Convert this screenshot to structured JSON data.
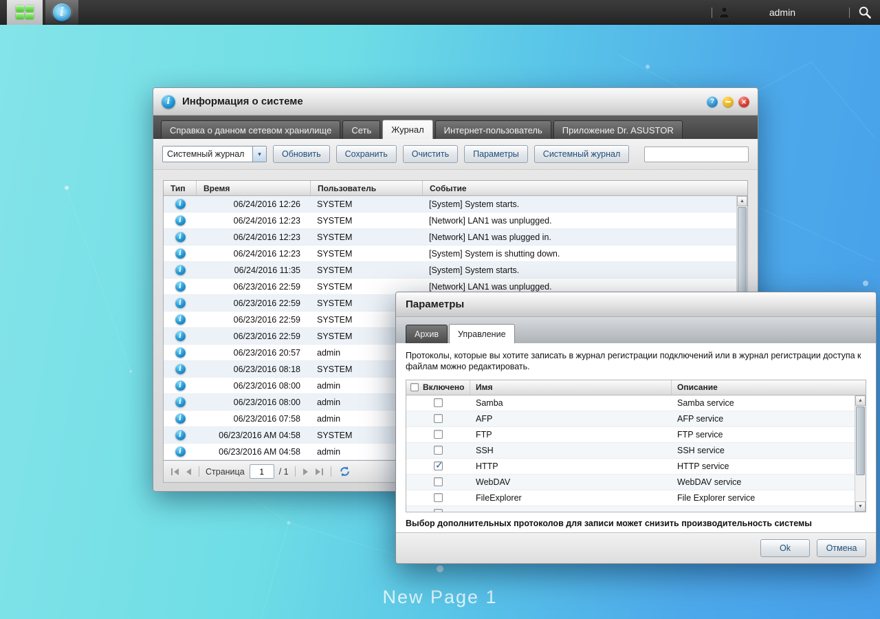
{
  "theme": {
    "accent_blue": "#2b7bc8",
    "info_icon_blue": "#2196d4",
    "button_text_blue": "#1f4e79",
    "desktop_gradient_left": "#84e4e9",
    "desktop_gradient_right": "#479fe9",
    "stripe_row": "#ecf2f7"
  },
  "icons": {
    "info_glyph": "i",
    "help_glyph": "?",
    "close_glyph": "×",
    "combo_arrow": "▾",
    "scroll_up": "▲",
    "scroll_down": "▼"
  },
  "taskbar": {
    "username": "admin"
  },
  "desktop": {
    "caption": "New Page 1"
  },
  "window": {
    "title": "Информация о системе",
    "tabs": [
      {
        "label": "Справка о данном сетевом хранилище",
        "active": false
      },
      {
        "label": "Сеть",
        "active": false
      },
      {
        "label": "Журнал",
        "active": true
      },
      {
        "label": "Интернет-пользователь",
        "active": false
      },
      {
        "label": "Приложение Dr. ASUSTOR",
        "active": false
      }
    ],
    "toolbar": {
      "dropdown_value": "Системный журнал",
      "buttons": [
        "Обновить",
        "Сохранить",
        "Очистить",
        "Параметры",
        "Системный журнал"
      ],
      "filter_value": ""
    },
    "table": {
      "columns": [
        "Тип",
        "Время",
        "Пользователь",
        "Событие"
      ],
      "rows": [
        {
          "time": "06/24/2016 12:26",
          "user": "SYSTEM",
          "event": "[System] System starts."
        },
        {
          "time": "06/24/2016 12:23",
          "user": "SYSTEM",
          "event": "[Network] LAN1 was unplugged."
        },
        {
          "time": "06/24/2016 12:23",
          "user": "SYSTEM",
          "event": "[Network] LAN1 was plugged in."
        },
        {
          "time": "06/24/2016 12:23",
          "user": "SYSTEM",
          "event": "[System] System is shutting down."
        },
        {
          "time": "06/24/2016 11:35",
          "user": "SYSTEM",
          "event": "[System] System starts."
        },
        {
          "time": "06/23/2016 22:59",
          "user": "SYSTEM",
          "event": "[Network] LAN1 was unplugged."
        },
        {
          "time": "06/23/2016 22:59",
          "user": "SYSTEM",
          "event": ""
        },
        {
          "time": "06/23/2016 22:59",
          "user": "SYSTEM",
          "event": ""
        },
        {
          "time": "06/23/2016 22:59",
          "user": "SYSTEM",
          "event": ""
        },
        {
          "time": "06/23/2016 20:57",
          "user": "admin",
          "event": ""
        },
        {
          "time": "06/23/2016 08:18",
          "user": "SYSTEM",
          "event": ""
        },
        {
          "time": "06/23/2016 08:00",
          "user": "admin",
          "event": ""
        },
        {
          "time": "06/23/2016 08:00",
          "user": "admin",
          "event": ""
        },
        {
          "time": "06/23/2016 07:58",
          "user": "admin",
          "event": ""
        },
        {
          "time": "06/23/2016 AM 04:58",
          "user": "SYSTEM",
          "event": ""
        },
        {
          "time": "06/23/2016 AM 04:58",
          "user": "admin",
          "event": ""
        }
      ]
    },
    "pagination": {
      "page_label": "Страница",
      "current_page": "1",
      "total_label": "/ 1"
    }
  },
  "dialog": {
    "title": "Параметры",
    "tabs": [
      {
        "label": "Архив",
        "active": false
      },
      {
        "label": "Управление",
        "active": true
      }
    ],
    "description": "Протоколы, которые вы хотите записать в журнал регистрации подключений или в журнал регистрации доступа к файлам можно редактировать.",
    "table": {
      "columns": [
        "Включено",
        "Имя",
        "Описание"
      ],
      "rows": [
        {
          "enabled": false,
          "name": "Samba",
          "desc": "Samba service"
        },
        {
          "enabled": false,
          "name": "AFP",
          "desc": "AFP service"
        },
        {
          "enabled": false,
          "name": "FTP",
          "desc": "FTP service"
        },
        {
          "enabled": false,
          "name": "SSH",
          "desc": "SSH service"
        },
        {
          "enabled": true,
          "name": "HTTP",
          "desc": "HTTP service"
        },
        {
          "enabled": false,
          "name": "WebDAV",
          "desc": "WebDAV service"
        },
        {
          "enabled": false,
          "name": "FileExplorer",
          "desc": "File Explorer service"
        },
        {
          "enabled": false,
          "name": "",
          "desc": ""
        }
      ]
    },
    "warning": "Выбор дополнительных протоколов для записи может снизить производительность системы",
    "buttons": {
      "ok": "Ok",
      "cancel": "Отмена"
    }
  }
}
